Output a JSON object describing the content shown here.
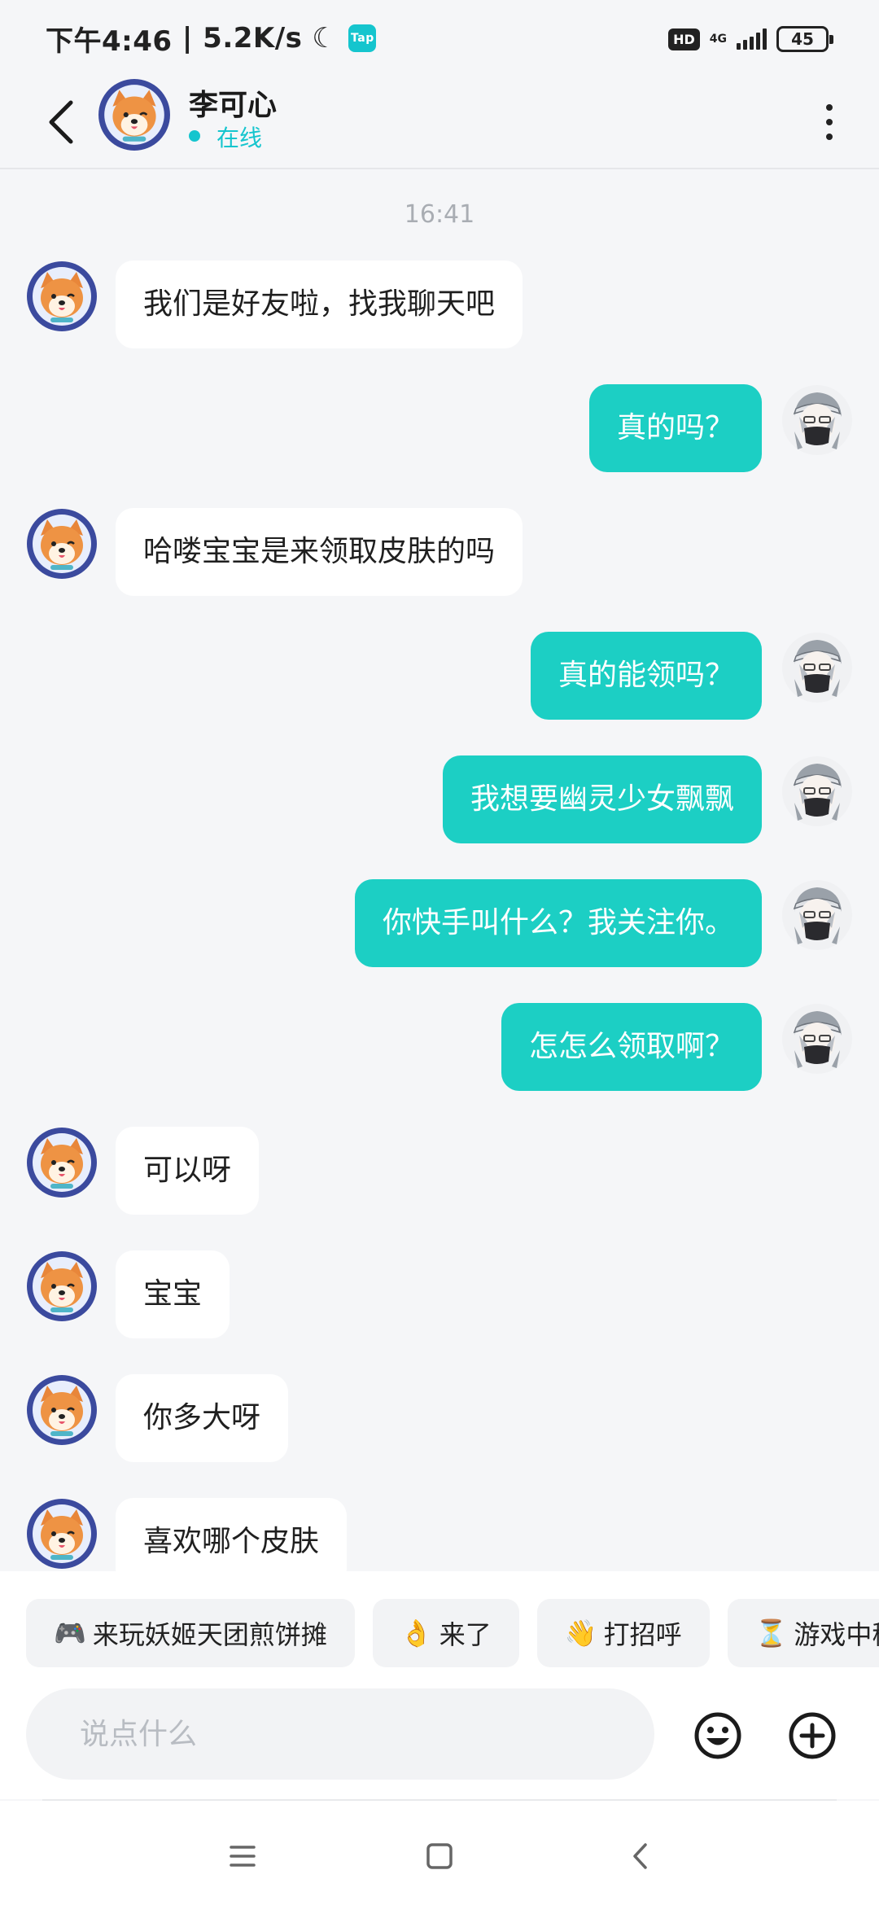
{
  "status_bar": {
    "time": "下午4:46",
    "speed": "5.2K/s",
    "app_badge": "Tap",
    "hd": "HD",
    "network": "4G",
    "battery": "45"
  },
  "header": {
    "contact_name": "李可心",
    "status": "在线"
  },
  "chat": {
    "timestamp": "16:41",
    "messages": [
      {
        "side": "in",
        "text": "我们是好友啦，找我聊天吧"
      },
      {
        "side": "out",
        "text": "真的吗？"
      },
      {
        "side": "in",
        "text": "哈喽宝宝是来领取皮肤的吗"
      },
      {
        "side": "out",
        "text": "真的能领吗？"
      },
      {
        "side": "out",
        "text": "我想要幽灵少女飘飘"
      },
      {
        "side": "out",
        "text": "你快手叫什么？我关注你。"
      },
      {
        "side": "out",
        "text": "怎怎么领取啊？"
      },
      {
        "side": "in",
        "text": "可以呀"
      },
      {
        "side": "in",
        "text": "宝宝"
      },
      {
        "side": "in",
        "text": "你多大呀"
      },
      {
        "side": "in",
        "text": "喜欢哪个皮肤"
      }
    ]
  },
  "quick_replies": [
    {
      "emoji": "🎮",
      "text": "来玩妖姬天团煎饼摊"
    },
    {
      "emoji": "👌",
      "text": "来了"
    },
    {
      "emoji": "👋",
      "text": "打招呼"
    },
    {
      "emoji": "⏳",
      "text": "游戏中稍"
    }
  ],
  "input": {
    "placeholder": "说点什么"
  },
  "colors": {
    "accent": "#15c5ce",
    "outgoing_bubble": "#1ccfc4",
    "background": "#f5f6f8"
  }
}
